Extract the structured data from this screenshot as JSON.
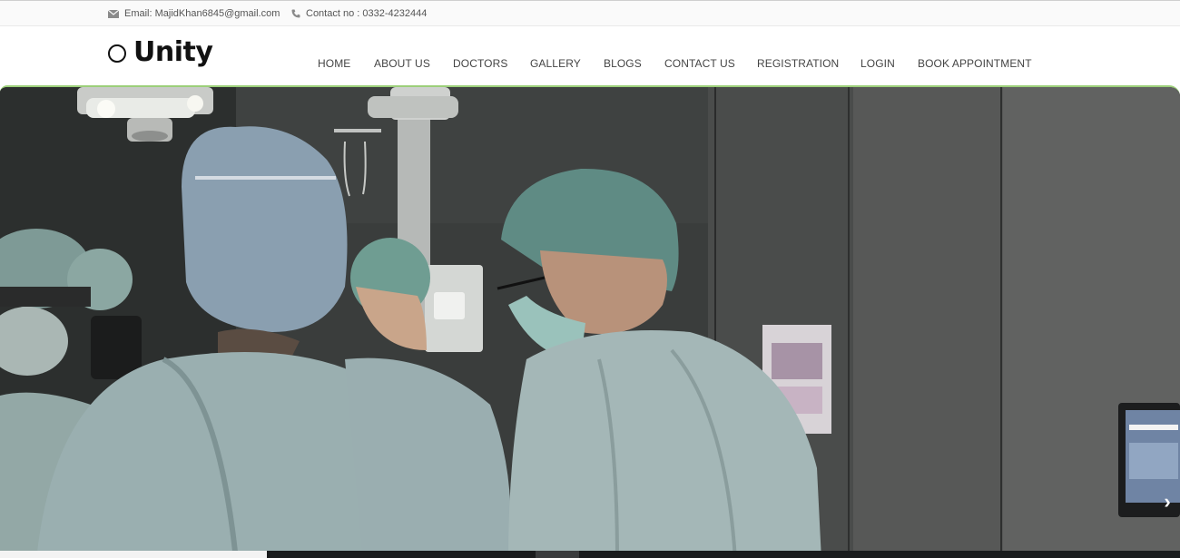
{
  "topbar": {
    "email": "Email: MajidKhan6845@gmail.com",
    "contact": "Contact no : 0332-4232444",
    "email_icon": "envelope-icon",
    "phone_icon": "phone-icon"
  },
  "brand": {
    "name": "Unity",
    "logo_icon": "ring-icon"
  },
  "nav": {
    "items": [
      {
        "label": "HOME"
      },
      {
        "label": "ABOUT US"
      },
      {
        "label": "DOCTORS"
      },
      {
        "label": "GALLERY"
      },
      {
        "label": "BLOGS"
      },
      {
        "label": "CONTACT US"
      },
      {
        "label": "REGISTRATION"
      },
      {
        "label": "LOGIN"
      },
      {
        "label": "BOOK APPOINTMENT"
      }
    ]
  },
  "hero": {
    "next_arrow_icon": "chevron-right-icon",
    "next_arrow_glyph": "›"
  },
  "colors": {
    "accent_border": "#9ccf7a",
    "text": "#444444"
  }
}
